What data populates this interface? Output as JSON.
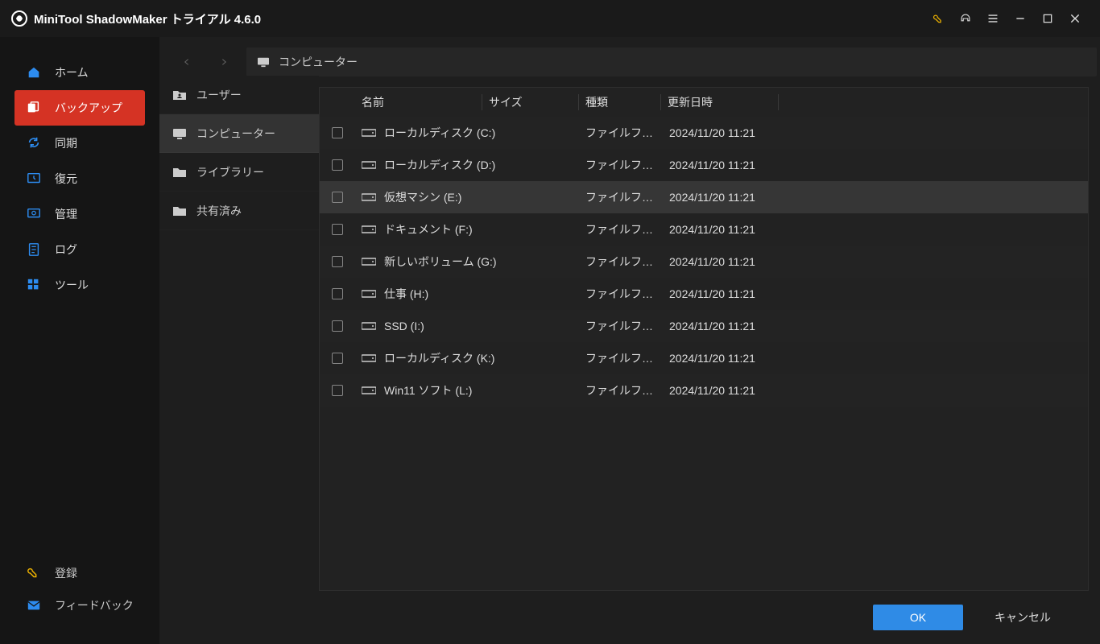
{
  "titlebar": {
    "app_title": "MiniTool ShadowMaker トライアル 4.6.0"
  },
  "sidebar": {
    "items": [
      {
        "label": "ホーム",
        "icon": "home-icon"
      },
      {
        "label": "バックアップ",
        "icon": "backup-icon",
        "active": true
      },
      {
        "label": "同期",
        "icon": "sync-icon"
      },
      {
        "label": "復元",
        "icon": "restore-icon"
      },
      {
        "label": "管理",
        "icon": "manage-icon"
      },
      {
        "label": "ログ",
        "icon": "log-icon"
      },
      {
        "label": "ツール",
        "icon": "tools-icon"
      }
    ],
    "bottom": [
      {
        "label": "登録",
        "icon": "register-icon"
      },
      {
        "label": "フィードバック",
        "icon": "feedback-icon"
      }
    ]
  },
  "breadcrumb": {
    "label": "コンピューター"
  },
  "tree": {
    "items": [
      {
        "label": "ユーザー"
      },
      {
        "label": "コンピューター",
        "active": true
      },
      {
        "label": "ライブラリー"
      },
      {
        "label": "共有済み"
      }
    ]
  },
  "columns": {
    "name": "名前",
    "size": "サイズ",
    "type": "種類",
    "date": "更新日時"
  },
  "rows": [
    {
      "name": "ローカルディスク (C:)",
      "type": "ファイルフォルダ",
      "date": "2024/11/20 11:21"
    },
    {
      "name": "ローカルディスク (D:)",
      "type": "ファイルフォルダ",
      "date": "2024/11/20 11:21"
    },
    {
      "name": "仮想マシン (E:)",
      "type": "ファイルフォルダ",
      "date": "2024/11/20 11:21",
      "hover": true
    },
    {
      "name": "ドキュメント (F:)",
      "type": "ファイルフォルダ",
      "date": "2024/11/20 11:21"
    },
    {
      "name": "新しいボリューム (G:)",
      "type": "ファイルフォルダ",
      "date": "2024/11/20 11:21"
    },
    {
      "name": "仕事 (H:)",
      "type": "ファイルフォルダ",
      "date": "2024/11/20 11:21"
    },
    {
      "name": "SSD (I:)",
      "type": "ファイルフォルダ",
      "date": "2024/11/20 11:21"
    },
    {
      "name": "ローカルディスク (K:)",
      "type": "ファイルフォルダ",
      "date": "2024/11/20 11:21"
    },
    {
      "name": "Win11 ソフト (L:)",
      "type": "ファイルフォルダ",
      "date": "2024/11/20 11:21"
    }
  ],
  "footer": {
    "ok": "OK",
    "cancel": "キャンセル"
  }
}
